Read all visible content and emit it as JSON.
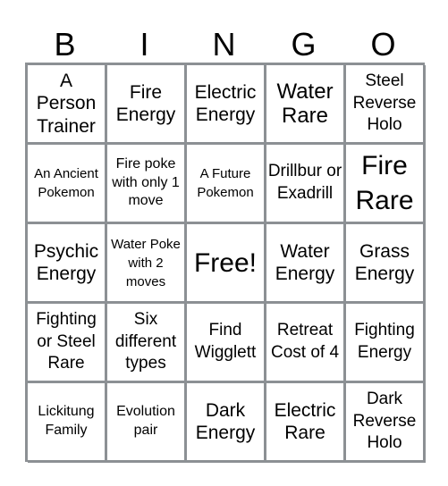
{
  "card": {
    "header_letters": [
      "B",
      "I",
      "N",
      "G",
      "O"
    ],
    "rows": [
      [
        "A Person Trainer",
        "Fire Energy",
        "Electric Energy",
        "Water Rare",
        "Steel Reverse Holo"
      ],
      [
        "An Ancient Pokemon",
        "Fire poke with only 1 move",
        "A Future Pokemon",
        "Drillbur or Exadrill",
        "Fire Rare"
      ],
      [
        "Psychic Energy",
        "Water Poke with 2 moves",
        "Free!",
        "Water Energy",
        "Grass Energy"
      ],
      [
        "Fighting or Steel Rare",
        "Six different types",
        "Find Wigglett",
        "Retreat Cost of 4",
        "Fighting Energy"
      ],
      [
        "Lickitung Family",
        "Evolution pair",
        "Dark Energy",
        "Electric Rare",
        "Dark Reverse Holo"
      ]
    ]
  },
  "colors": {
    "grid_line": "#8c9094",
    "cell_background": "#ffffff",
    "text": "#000000"
  }
}
